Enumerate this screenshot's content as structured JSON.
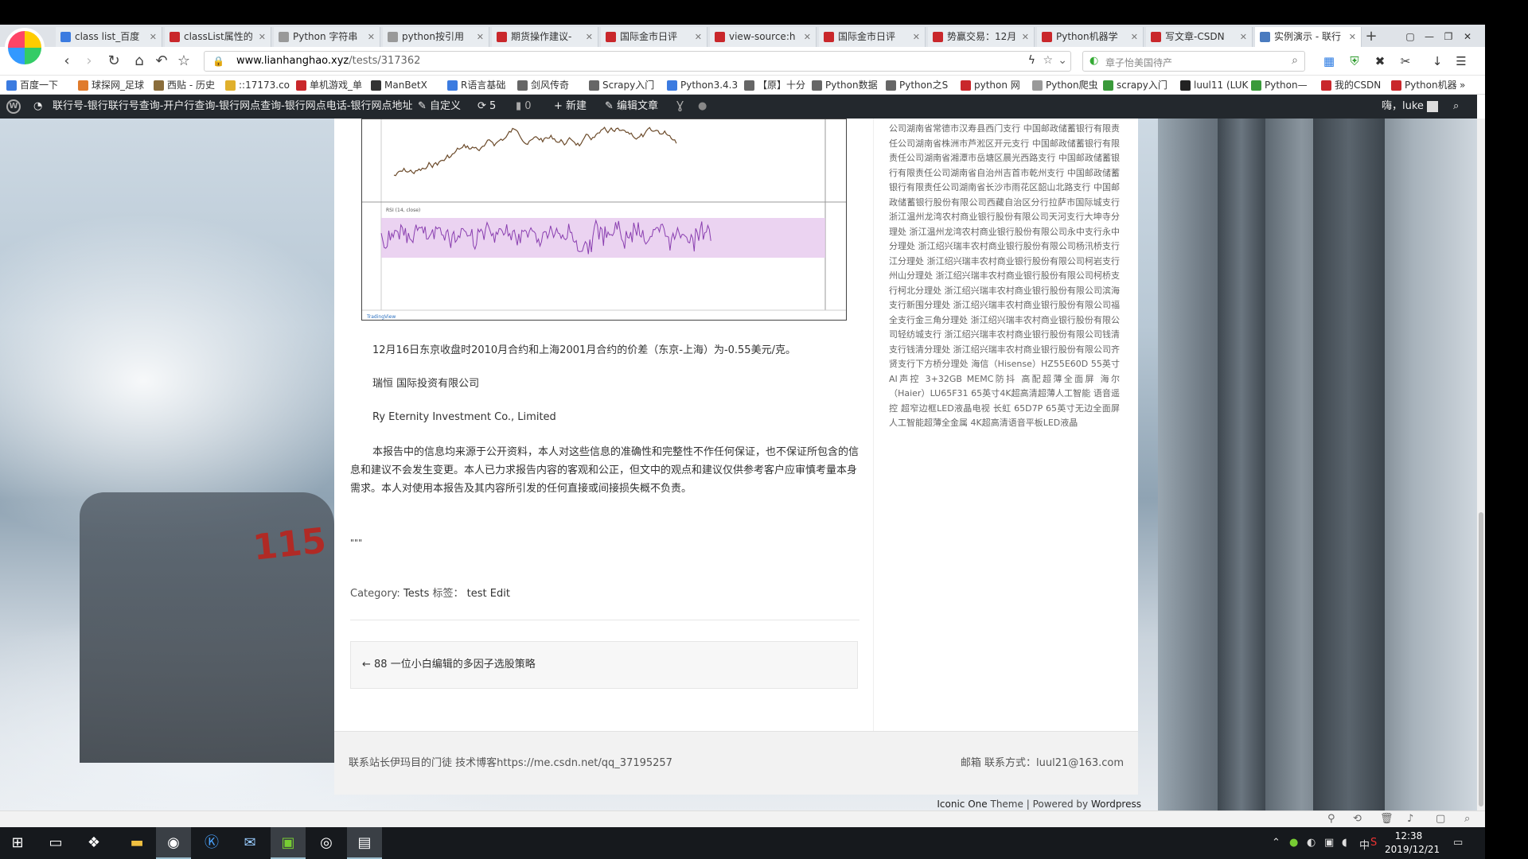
{
  "tabs": [
    {
      "label": "class list_百度",
      "color": "#3b7be0"
    },
    {
      "label": "classList属性的",
      "color": "#c9272b"
    },
    {
      "label": "Python 字符串",
      "color": "#999999"
    },
    {
      "label": "python按引用",
      "color": "#999999"
    },
    {
      "label": "期货操作建议-",
      "color": "#c9272b"
    },
    {
      "label": "国际金市日评",
      "color": "#c9272b"
    },
    {
      "label": "view-source:h",
      "color": "#c9272b"
    },
    {
      "label": "国际金市日评",
      "color": "#c9272b"
    },
    {
      "label": "势赢交易：12月",
      "color": "#c9272b"
    },
    {
      "label": "Python机器学",
      "color": "#c9272b"
    },
    {
      "label": "写文章-CSDN",
      "color": "#c9272b"
    },
    {
      "label": "实例演示 - 联行",
      "color": "#4a7bbf",
      "active": true
    }
  ],
  "address": {
    "domain": "www.lianhanghao.xyz",
    "path": "/tests/317362"
  },
  "search": {
    "placeholder": "章子怡美国待产"
  },
  "bookmarks": [
    {
      "label": "百度一下",
      "color": "#3b7be0"
    },
    {
      "label": "球探网_足球",
      "color": "#e07b2c"
    },
    {
      "label": "西贴 - 历史",
      "color": "#8a6d3b"
    },
    {
      "label": "::17173.co",
      "color": "#e0b02c"
    },
    {
      "label": "单机游戏_单",
      "color": "#c9272b"
    },
    {
      "label": "ManBetX",
      "color": "#333333"
    },
    {
      "label": "R语言基础",
      "color": "#3b7be0"
    },
    {
      "label": "剑风传奇",
      "color": "#666666"
    },
    {
      "label": "Scrapy入门",
      "color": "#666666"
    },
    {
      "label": "Python3.4.3",
      "color": "#3b7be0"
    },
    {
      "label": "【原】十分",
      "color": "#666666"
    },
    {
      "label": "Python数据",
      "color": "#666666"
    },
    {
      "label": "Python之S",
      "color": "#666666"
    },
    {
      "label": "python 网",
      "color": "#c9272b"
    },
    {
      "label": "Python爬虫",
      "color": "#999999"
    },
    {
      "label": "scrapy入门",
      "color": "#3a9a3a"
    },
    {
      "label": "luul11 (LUK",
      "color": "#222222"
    },
    {
      "label": "Python—",
      "color": "#3a9a3a"
    },
    {
      "label": "我的CSDN",
      "color": "#c9272b"
    },
    {
      "label": "Python机器",
      "color": "#c9272b"
    }
  ],
  "wpbar": {
    "site_title": "联行号-银行联行号查询-开户行查询-银行网点查询-银行网点电话-银行网点地址",
    "customize": "自定义",
    "updates": "5",
    "comments": "0",
    "new": "新建",
    "edit": "编辑文章",
    "greeting": "嗨，luke"
  },
  "article": {
    "p1": "12月16日东京收盘时2010月合约和上海2001月合约的价差（东京-上海）为-0.55美元/克。",
    "p2": "瑞恒 国际投资有限公司",
    "p3": "Ry Eternity Investment Co., Limited",
    "p4": "本报告中的信息均来源于公开资料，本人对这些信息的准确性和完整性不作任何保证，也不保证所包含的信息和建议不会发生变更。本人已力求报告内容的客观和公正，但文中的观点和建议仅供参考客户应审慎考量本身需求。本人对使用本报告及其内容所引发的任何直接或间接损失概不负责。",
    "p5": "\"\"\"",
    "category_label": "Category:",
    "category": "Tests",
    "tags_label": "标签：",
    "tag": "test",
    "edit_link": "Edit",
    "prev_post": "← 88 一位小白编辑的多因子选股策略"
  },
  "chart": {
    "indicator_label": "RSI (14, close)",
    "watermark": "TradingView"
  },
  "sidebar": {
    "text": "公司湖南省常德市汉寿县西门支行 中国邮政储蓄银行有限责任公司湖南省株洲市芦淞区开元支行 中国邮政储蓄银行有限责任公司湖南省湘潭市岳塘区晨光西路支行 中国邮政储蓄银行有限责任公司湖南省自治州吉首市乾州支行 中国邮政储蓄银行有限责任公司湖南省长沙市雨花区韶山北路支行 中国邮政储蓄银行股份有限公司西藏自治区分行拉萨市国际城支行 浙江温州龙湾农村商业银行股份有限公司天河支行大坤寺分理处 浙江温州龙湾农村商业银行股份有限公司永中支行永中分理处 浙江绍兴瑞丰农村商业银行股份有限公司杨汛桥支行江分理处 浙江绍兴瑞丰农村商业银行股份有限公司柯岩支行州山分理处 浙江绍兴瑞丰农村商业银行股份有限公司柯桥支行柯北分理处 浙江绍兴瑞丰农村商业银行股份有限公司滨海支行新围分理处 浙江绍兴瑞丰农村商业银行股份有限公司福全支行金三角分理处 浙江绍兴瑞丰农村商业银行股份有限公司轻纺城支行 浙江绍兴瑞丰农村商业银行股份有限公司钱清支行钱清分理处 浙江绍兴瑞丰农村商业银行股份有限公司齐贤支行下方桥分理处 海信（Hisense）HZ55E60D 55英寸 AI声控 3+32GB MEMC防抖 高配超薄全面屏 海尔（Haier）LU65F31 65英寸4K超高清超薄人工智能 语音遥控 超窄边框LED液晶电视 长虹 65D7P 65英寸无边全面屏 人工智能超薄全金属 4K超高清语音平板LED液晶"
  },
  "footer": {
    "left": "联系站长伊玛目的门徒 技术博客https://me.csdn.net/qq_37195257",
    "right": "邮箱 联系方式：luul21@163.com",
    "theme_link": "Iconic One",
    "theme_word": "Theme",
    "sep": "|",
    "powered": "Powered by",
    "wp_link": "Wordpress"
  },
  "taskbar": {
    "time": "12:38",
    "date": "2019/12/21",
    "ime": "中"
  }
}
